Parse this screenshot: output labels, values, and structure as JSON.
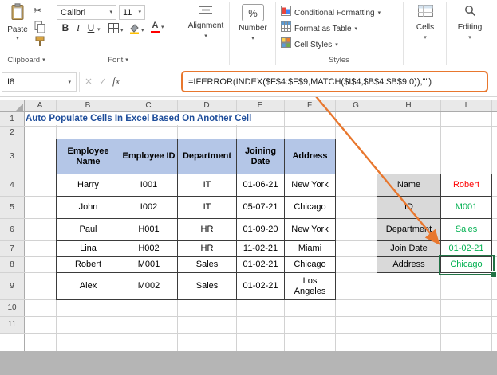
{
  "ribbon": {
    "paste_label": "Paste",
    "font_name": "Calibri",
    "font_size": "11",
    "bold": "B",
    "italic": "I",
    "underline": "U",
    "alignment_label": "Alignment",
    "number_label": "Number",
    "percent_symbol": "%",
    "conditional_formatting_label": "Conditional Formatting",
    "format_as_table_label": "Format as Table",
    "cell_styles_label": "Cell Styles",
    "cells_label": "Cells",
    "editing_label": "Editing",
    "clipboard_group_label": "Clipboard",
    "font_group_label": "Font",
    "styles_group_label": "Styles",
    "icons": {
      "dropdown": "▾",
      "cut": "✂",
      "font_color_letter": "A"
    }
  },
  "formula_bar": {
    "name_box": "I8",
    "cancel": "×",
    "enter": "✓",
    "fx": "fx",
    "formula": "=IFERROR(INDEX($F$4:$F$9,MATCH($I$4,$B$4:$B$9,0)),\"\")"
  },
  "grid": {
    "columns": [
      "A",
      "B",
      "C",
      "D",
      "E",
      "F",
      "G",
      "H",
      "I"
    ],
    "rows": [
      "1",
      "2",
      "3",
      "4",
      "5",
      "6",
      "7",
      "8",
      "9",
      "10",
      "11"
    ]
  },
  "sheet": {
    "title": "Auto Populate Cells In Excel Based On Another Cell"
  },
  "employee_table": {
    "headers": [
      "Employee Name",
      "Employee ID",
      "Department",
      "Joining Date",
      "Address"
    ],
    "rows": [
      [
        "Harry",
        "I001",
        "IT",
        "01-06-21",
        "New York"
      ],
      [
        "John",
        "I002",
        "IT",
        "05-07-21",
        "Chicago"
      ],
      [
        "Paul",
        "H001",
        "HR",
        "01-09-20",
        "New York"
      ],
      [
        "Lina",
        "H002",
        "HR",
        "11-02-21",
        "Miami"
      ],
      [
        "Robert",
        "M001",
        "Sales",
        "01-02-21",
        "Chicago"
      ],
      [
        "Alex",
        "M002",
        "Sales",
        "01-02-21",
        "Los Angeles"
      ]
    ]
  },
  "lookup_table": {
    "rows": [
      {
        "label": "Name",
        "value": "Robert"
      },
      {
        "label": "ID",
        "value": "M001"
      },
      {
        "label": "Department",
        "value": "Sales"
      },
      {
        "label": "Join Date",
        "value": "01-02-21"
      },
      {
        "label": "Address",
        "value": "Chicago"
      }
    ]
  },
  "colors": {
    "table_header_fill": "#B4C6E7",
    "lookup_label_fill": "#D9D9D9",
    "title_text": "#1F4E9B",
    "name_value_text": "#FF0000",
    "matched_value_text": "#00B050",
    "formula_highlight": "#E8772E",
    "selection_border": "#217346"
  }
}
